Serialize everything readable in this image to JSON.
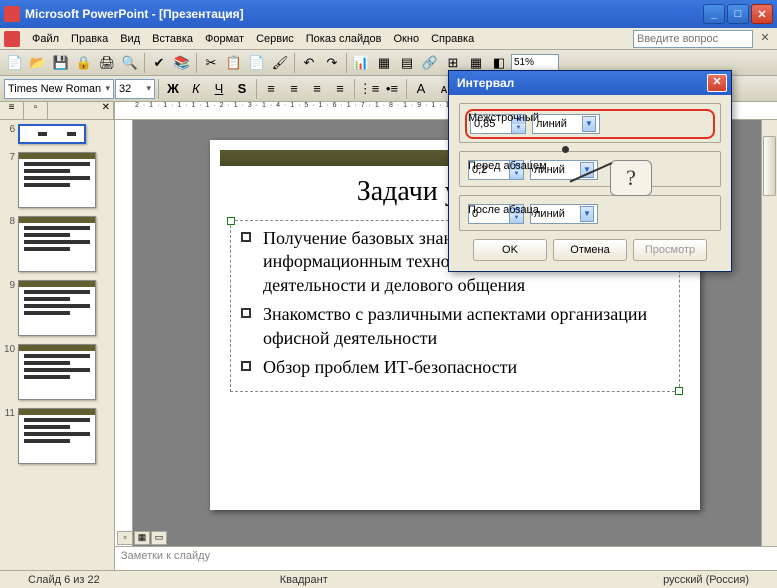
{
  "app": {
    "title": "Microsoft PowerPoint - [Презентация]"
  },
  "menu": [
    "Файл",
    "Правка",
    "Вид",
    "Вставка",
    "Формат",
    "Сервис",
    "Показ слайдов",
    "Окно",
    "Справка"
  ],
  "ask_placeholder": "Введите вопрос",
  "toolbar": {
    "font": "Times New Roman",
    "size": "32",
    "zoom": "51%",
    "bold": "Ж",
    "italic": "К",
    "underline": "Ч",
    "shadow": "S"
  },
  "thumbs": [
    6,
    7,
    8,
    9,
    10,
    11
  ],
  "selected_thumb": 6,
  "slide": {
    "title": "Задачи учебного",
    "bullets": [
      "Получение базовых знаний, умений и навыков по информационным технологиям, основам офисной деятельности и делового общения",
      "Знакомство с различными аспектами организации офисной деятельности",
      "Обзор проблем ИТ-безопасности"
    ]
  },
  "notes_placeholder": "Заметки к слайду",
  "status": {
    "slide": "Слайд 6 из 22",
    "layout": "Квадрант",
    "lang": "русский (Россия)"
  },
  "dialog": {
    "title": "Интервал",
    "g1": "Межстрочный",
    "v1": "0,85",
    "u1": "линий",
    "g2": "Перед абзацем",
    "v2": "0,2",
    "u2": "линий",
    "g3": "После абзаца",
    "v3": "0",
    "u3": "линий",
    "ok": "OK",
    "cancel": "Отмена",
    "preview": "Просмотр"
  },
  "callout": "?",
  "ruler": "2 · 1 · 1 · 1 · 1 · 1 · 2 · 1 · 3 · 1 · 4 · 1 · 5 · 1 · 6 · 1 · 7 · 1 · 8 · 1 · 9 · 1 · 10 · 1 · 11 · 1 · 12"
}
